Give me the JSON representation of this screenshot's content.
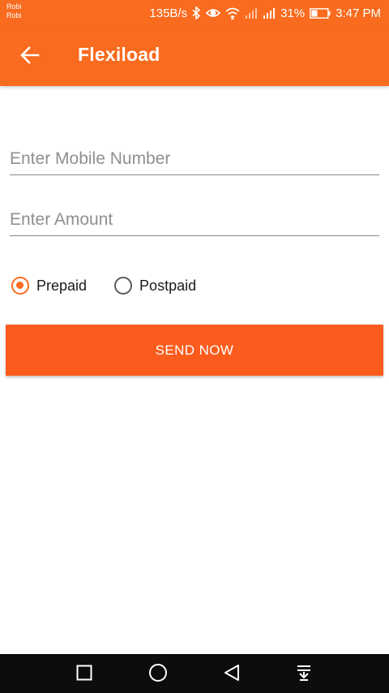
{
  "status_bar": {
    "carrier_1": "Robi",
    "carrier_2": "Robi",
    "network_speed": "135B/s",
    "battery_percent": "31%",
    "time": "3:47 PM",
    "icons": [
      "bluetooth-icon",
      "eye-icon",
      "wifi-icon",
      "signal-icon",
      "signal-icon",
      "battery-icon"
    ]
  },
  "app_bar": {
    "title": "Flexiload",
    "back_icon": "arrow-left-icon"
  },
  "form": {
    "mobile_placeholder": "Enter Mobile Number",
    "mobile_value": "",
    "amount_placeholder": "Enter Amount",
    "amount_value": "",
    "radio_options": [
      {
        "label": "Prepaid",
        "checked": true
      },
      {
        "label": "Postpaid",
        "checked": false
      }
    ],
    "submit_label": "SEND NOW"
  },
  "nav_bar": {
    "icons": [
      "recents-square-icon",
      "home-circle-icon",
      "back-triangle-icon",
      "notification-pull-icon"
    ]
  },
  "colors": {
    "primary": "#f96b1e",
    "button": "#fb5b1c",
    "nav_background": "#0d0d0d"
  }
}
